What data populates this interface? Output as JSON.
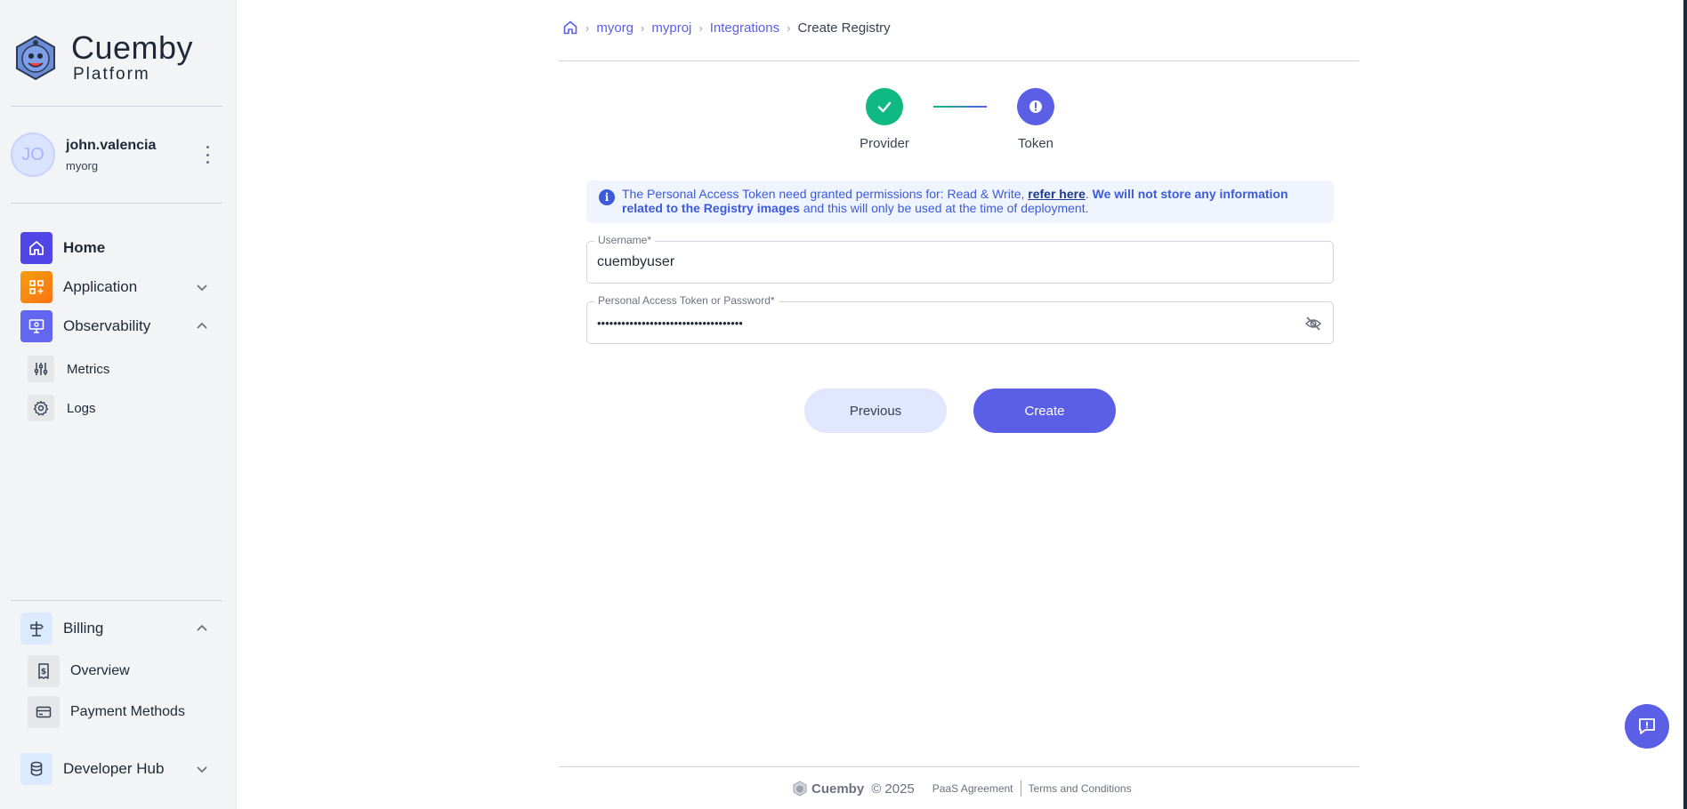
{
  "brand": {
    "name": "Cuemby",
    "subtitle": "Platform"
  },
  "user": {
    "initials": "JO",
    "name": "john.valencia",
    "org": "myorg"
  },
  "sidebar": {
    "items": [
      {
        "label": "Home"
      },
      {
        "label": "Application"
      },
      {
        "label": "Observability"
      },
      {
        "label": "Metrics"
      },
      {
        "label": "Logs"
      },
      {
        "label": "Billing"
      },
      {
        "label": "Overview"
      },
      {
        "label": "Payment Methods"
      },
      {
        "label": "Developer Hub"
      }
    ]
  },
  "breadcrumb": {
    "org": "myorg",
    "project": "myproj",
    "section": "Integrations",
    "current": "Create Registry"
  },
  "steps": [
    {
      "label": "Provider",
      "state": "completed"
    },
    {
      "label": "Token",
      "state": "current"
    }
  ],
  "info": {
    "text_a": "The Personal Access Token need granted permissions for: Read & Write, ",
    "link": "refer here",
    "text_b": ". ",
    "bold": "We will not store any information related to the Registry images",
    "text_c": " and this will only be used at the time of deployment."
  },
  "form": {
    "username": {
      "label": "Username*",
      "value": "cuembyuser"
    },
    "token": {
      "label": "Personal Access Token or Password*",
      "value": "••••••••••••••••••••••••••••••••••••"
    }
  },
  "buttons": {
    "previous": "Previous",
    "create": "Create"
  },
  "footer": {
    "brand": "Cuemby",
    "year": "© 2025",
    "paas": "PaaS Agreement",
    "terms": "Terms and Conditions"
  },
  "colors": {
    "accent": "#5b5fe6",
    "success": "#10b981",
    "home_icon_bg": "#4f46e5",
    "application_icon_bg": "#f59e0b",
    "observability_icon_bg": "#6366f1"
  },
  "icons": {
    "home": "home-icon",
    "application": "grid-plus-icon",
    "observability": "monitor-icon",
    "metrics": "sliders-icon",
    "logs": "gear-icon",
    "billing": "signpost-icon",
    "overview": "invoice-icon",
    "payment": "credit-card-icon",
    "developer_hub": "database-icon",
    "chat": "message-icon"
  }
}
